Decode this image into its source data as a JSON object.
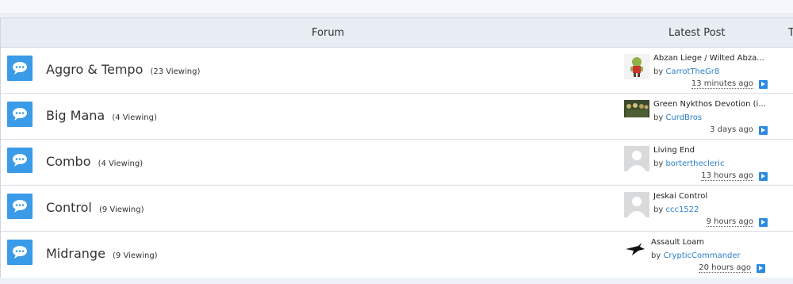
{
  "header": {
    "forum_label": "Forum",
    "latest_label": "Latest Post",
    "topics_label": "T"
  },
  "forums": [
    {
      "title": "Aggro & Tempo",
      "viewing": "(23 Viewing)",
      "latest_title": "Abzan Liege / Wilted Abza...",
      "by": "by",
      "user": "CarrotTheGr8",
      "time": "13 minutes ago",
      "avatar": "goblin-avatar"
    },
    {
      "title": "Big Mana",
      "viewing": "(4 Viewing)",
      "latest_title": "Green Nykthos Devotion (i...",
      "by": "by",
      "user": "CurdBros",
      "time": "3 days ago",
      "avatar": "group-avatar"
    },
    {
      "title": "Combo",
      "viewing": "(4 Viewing)",
      "latest_title": "Living End",
      "by": "by",
      "user": "borterthecleric",
      "time": "13 hours ago",
      "avatar": "default-avatar"
    },
    {
      "title": "Control",
      "viewing": "(9 Viewing)",
      "latest_title": "Jeskai Control",
      "by": "by",
      "user": "ccc1522",
      "time": "9 hours ago",
      "avatar": "default-avatar"
    },
    {
      "title": "Midrange",
      "viewing": "(9 Viewing)",
      "latest_title": "Assault Loam",
      "by": "by",
      "user": "CrypticCommander",
      "time": "20 hours ago",
      "avatar": "bird-avatar"
    }
  ],
  "colors": {
    "accent": "#3a9be8",
    "link": "#2c7fc8",
    "header_bg": "#e8edf3"
  }
}
